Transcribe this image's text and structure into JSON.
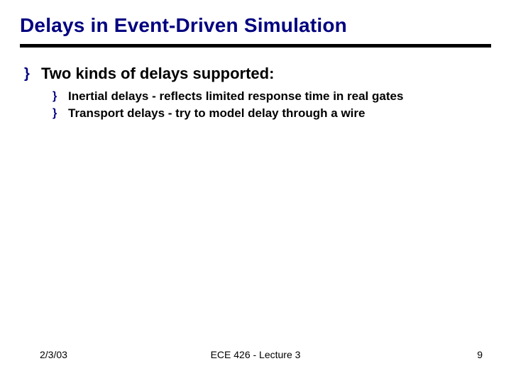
{
  "title": "Delays in Event-Driven Simulation",
  "bullet_glyph": "}",
  "main": {
    "text": "Two kinds of delays supported:",
    "subs": [
      "Inertial delays - reflects limited response time in real gates",
      "Transport delays - try to model delay through a wire"
    ]
  },
  "footer": {
    "date": "2/3/03",
    "center": "ECE 426 - Lecture 3",
    "page": "9"
  }
}
